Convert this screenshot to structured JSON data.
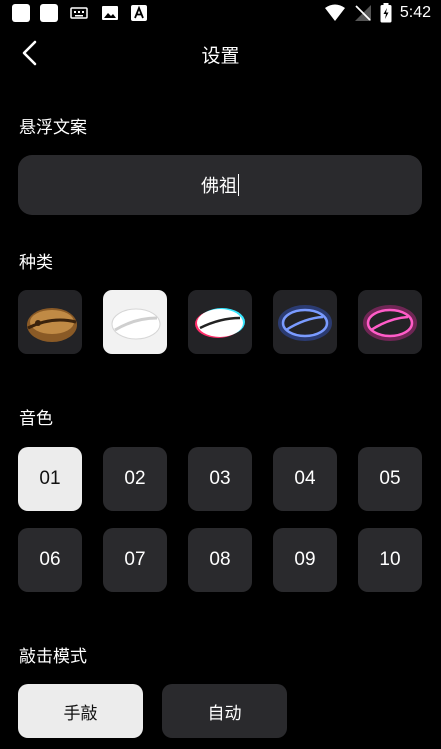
{
  "status_bar": {
    "time": "5:42"
  },
  "header": {
    "title": "设置"
  },
  "floating_text": {
    "label": "悬浮文案",
    "value": "佛祖"
  },
  "kinds": {
    "label": "种类",
    "items": [
      "wooden-fish-icon",
      "white-fish-icon",
      "glitch-fish-icon",
      "neon-blue-fish-icon",
      "neon-pink-fish-icon"
    ],
    "selected": 1
  },
  "tones": {
    "label": "音色",
    "items": [
      "01",
      "02",
      "03",
      "04",
      "05",
      "06",
      "07",
      "08",
      "09",
      "10"
    ],
    "selected": "01"
  },
  "knock_mode": {
    "label": "敲击模式",
    "options": [
      "手敲",
      "自动"
    ],
    "selected": "手敲"
  },
  "colors": {
    "background": "#000000",
    "field": "#2a2a2d",
    "selected": "#ececec",
    "neon_blue": "#3d6bff",
    "neon_pink": "#ff2fb0"
  }
}
